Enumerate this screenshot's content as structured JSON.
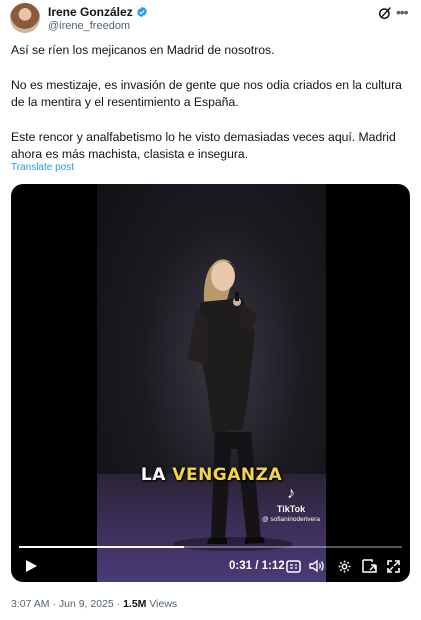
{
  "author": {
    "display_name": "Irene González",
    "handle": "@irene_freedom",
    "verified_color": "#1d9bf0"
  },
  "tweet": {
    "paragraphs": [
      "Así se ríen los mejicanos en Madrid de nosotros.",
      "No es mestizaje, es invasión de gente que nos odia criados en la cultura de la mentira y el resentimiento a España.",
      "Este rencor y analfabetismo lo he visto demasiadas veces aquí. Madrid ahora es más machista, clasista e insegura."
    ],
    "translate_label": "Translate post"
  },
  "video": {
    "caption_plain": "LA ",
    "caption_accent": "VENGANZA",
    "tiktok_brand": "TikTok",
    "tiktok_user": "@ sofianinoderivera",
    "current_time": "0:31",
    "duration": "1:12",
    "time_display": "0:31 / 1:12",
    "progress": 0.43
  },
  "meta": {
    "timestamp": "3:07 AM · Jun 9, 2025 · ",
    "views_count": "1.5M",
    "views_label": " Views"
  },
  "icons": {
    "grok": "grok-icon",
    "more": "more-icon",
    "play": "play-icon",
    "captions": "captions-icon",
    "volume": "volume-icon",
    "settings": "settings-icon",
    "pip": "picture-in-picture-icon",
    "fullscreen": "fullscreen-icon"
  }
}
